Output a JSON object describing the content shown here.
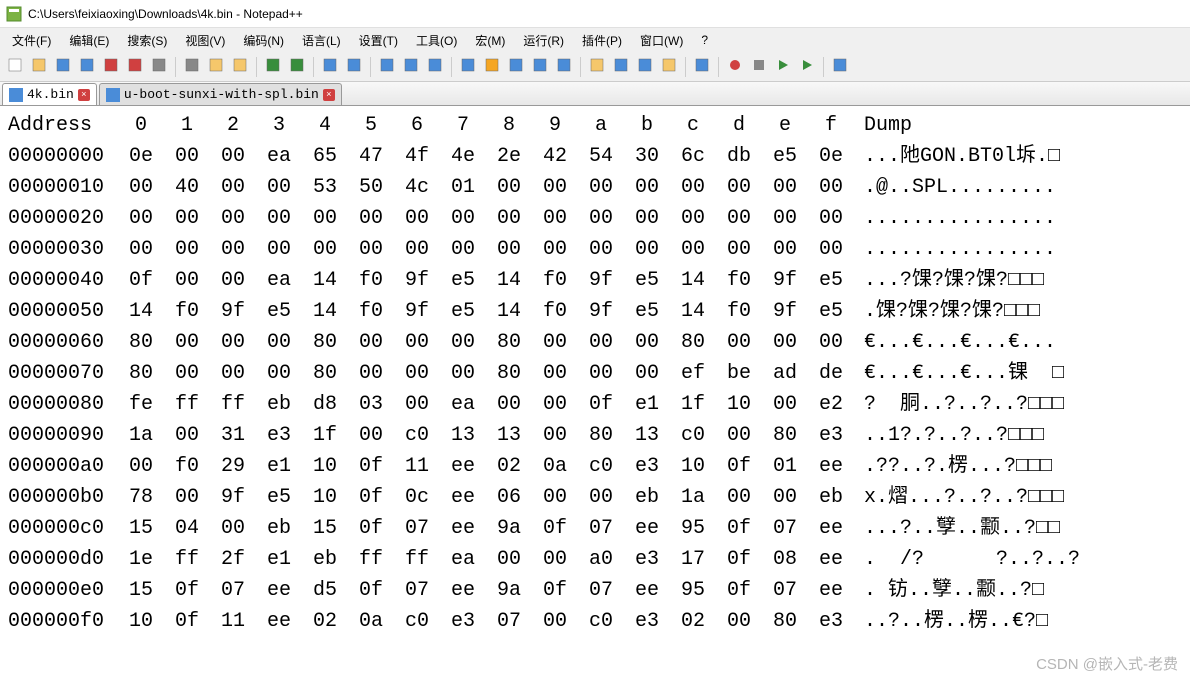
{
  "title": "C:\\Users\\feixiaoxing\\Downloads\\4k.bin - Notepad++",
  "menu": {
    "items": [
      {
        "label": "文件(F)",
        "key": "F"
      },
      {
        "label": "编辑(E)",
        "key": "E"
      },
      {
        "label": "搜索(S)",
        "key": "S"
      },
      {
        "label": "视图(V)",
        "key": "V"
      },
      {
        "label": "编码(N)",
        "key": "N"
      },
      {
        "label": "语言(L)",
        "key": "L"
      },
      {
        "label": "设置(T)",
        "key": "T"
      },
      {
        "label": "工具(O)",
        "key": "O"
      },
      {
        "label": "宏(M)",
        "key": "M"
      },
      {
        "label": "运行(R)",
        "key": "R"
      },
      {
        "label": "插件(P)",
        "key": "P"
      },
      {
        "label": "窗口(W)",
        "key": "W"
      },
      {
        "label": "?",
        "key": "?"
      }
    ]
  },
  "toolbar_icons": [
    "new-file",
    "open-file",
    "save",
    "save-all",
    "close",
    "close-all",
    "print",
    "sep",
    "cut",
    "copy",
    "paste",
    "sep",
    "undo",
    "redo",
    "sep",
    "find",
    "replace",
    "sep",
    "zoom-in",
    "zoom-out",
    "sync",
    "sep",
    "wordwrap",
    "all-chars",
    "indent",
    "fold",
    "unfold",
    "sep",
    "doc-map",
    "doc-list",
    "func-list",
    "folder",
    "sep",
    "monitor",
    "sep",
    "record",
    "stop",
    "play",
    "play-multi",
    "sep",
    "highlight"
  ],
  "tabs": [
    {
      "label": "4k.bin",
      "active": true
    },
    {
      "label": "u-boot-sunxi-with-spl.bin",
      "active": false
    }
  ],
  "hex": {
    "header_addr": "Address",
    "header_cols": [
      "0",
      "1",
      "2",
      "3",
      "4",
      "5",
      "6",
      "7",
      "8",
      "9",
      "a",
      "b",
      "c",
      "d",
      "e",
      "f"
    ],
    "header_dump": "Dump",
    "rows": [
      {
        "addr": "00000000",
        "b": [
          "0e",
          "00",
          "00",
          "ea",
          "65",
          "47",
          "4f",
          "4e",
          "2e",
          "42",
          "54",
          "30",
          "6c",
          "db",
          "e5",
          "0e"
        ],
        "dump": "...阤GON.BT0l坼.□"
      },
      {
        "addr": "00000010",
        "b": [
          "00",
          "40",
          "00",
          "00",
          "53",
          "50",
          "4c",
          "01",
          "00",
          "00",
          "00",
          "00",
          "00",
          "00",
          "00",
          "00"
        ],
        "dump": ".@..SPL........."
      },
      {
        "addr": "00000020",
        "b": [
          "00",
          "00",
          "00",
          "00",
          "00",
          "00",
          "00",
          "00",
          "00",
          "00",
          "00",
          "00",
          "00",
          "00",
          "00",
          "00"
        ],
        "dump": "................"
      },
      {
        "addr": "00000030",
        "b": [
          "00",
          "00",
          "00",
          "00",
          "00",
          "00",
          "00",
          "00",
          "00",
          "00",
          "00",
          "00",
          "00",
          "00",
          "00",
          "00"
        ],
        "dump": "................"
      },
      {
        "addr": "00000040",
        "b": [
          "0f",
          "00",
          "00",
          "ea",
          "14",
          "f0",
          "9f",
          "e5",
          "14",
          "f0",
          "9f",
          "e5",
          "14",
          "f0",
          "9f",
          "e5"
        ],
        "dump": "...?馃?馃?馃?□□□"
      },
      {
        "addr": "00000050",
        "b": [
          "14",
          "f0",
          "9f",
          "e5",
          "14",
          "f0",
          "9f",
          "e5",
          "14",
          "f0",
          "9f",
          "e5",
          "14",
          "f0",
          "9f",
          "e5"
        ],
        "dump": ".馃?馃?馃?馃?□□□"
      },
      {
        "addr": "00000060",
        "b": [
          "80",
          "00",
          "00",
          "00",
          "80",
          "00",
          "00",
          "00",
          "80",
          "00",
          "00",
          "00",
          "80",
          "00",
          "00",
          "00"
        ],
        "dump": "€...€...€...€..."
      },
      {
        "addr": "00000070",
        "b": [
          "80",
          "00",
          "00",
          "00",
          "80",
          "00",
          "00",
          "00",
          "80",
          "00",
          "00",
          "00",
          "ef",
          "be",
          "ad",
          "de"
        ],
        "dump": "€...€...€...锞  □"
      },
      {
        "addr": "00000080",
        "b": [
          "fe",
          "ff",
          "ff",
          "eb",
          "d8",
          "03",
          "00",
          "ea",
          "00",
          "00",
          "0f",
          "e1",
          "1f",
          "10",
          "00",
          "e2"
        ],
        "dump": "?  胴..?..?..?□□□"
      },
      {
        "addr": "00000090",
        "b": [
          "1a",
          "00",
          "31",
          "e3",
          "1f",
          "00",
          "c0",
          "13",
          "13",
          "00",
          "80",
          "13",
          "c0",
          "00",
          "80",
          "e3"
        ],
        "dump": "..1?.?..?..?□□□"
      },
      {
        "addr": "000000a0",
        "b": [
          "00",
          "f0",
          "29",
          "e1",
          "10",
          "0f",
          "11",
          "ee",
          "02",
          "0a",
          "c0",
          "e3",
          "10",
          "0f",
          "01",
          "ee"
        ],
        "dump": ".??..?.楞...?□□□"
      },
      {
        "addr": "000000b0",
        "b": [
          "78",
          "00",
          "9f",
          "e5",
          "10",
          "0f",
          "0c",
          "ee",
          "06",
          "00",
          "00",
          "eb",
          "1a",
          "00",
          "00",
          "eb"
        ],
        "dump": "x.熠...?..?..?□□□"
      },
      {
        "addr": "000000c0",
        "b": [
          "15",
          "04",
          "00",
          "eb",
          "15",
          "0f",
          "07",
          "ee",
          "9a",
          "0f",
          "07",
          "ee",
          "95",
          "0f",
          "07",
          "ee"
        ],
        "dump": "...?..孼..颥..?□□"
      },
      {
        "addr": "000000d0",
        "b": [
          "1e",
          "ff",
          "2f",
          "e1",
          "eb",
          "ff",
          "ff",
          "ea",
          "00",
          "00",
          "a0",
          "e3",
          "17",
          "0f",
          "08",
          "ee"
        ],
        "dump": ".  /?      ?..?..?"
      },
      {
        "addr": "000000e0",
        "b": [
          "15",
          "0f",
          "07",
          "ee",
          "d5",
          "0f",
          "07",
          "ee",
          "9a",
          "0f",
          "07",
          "ee",
          "95",
          "0f",
          "07",
          "ee"
        ],
        "dump": ". 钫..孼..颥..?□"
      },
      {
        "addr": "000000f0",
        "b": [
          "10",
          "0f",
          "11",
          "ee",
          "02",
          "0a",
          "c0",
          "e3",
          "07",
          "00",
          "c0",
          "e3",
          "02",
          "00",
          "80",
          "e3"
        ],
        "dump": "..?..楞..楞..€?□"
      }
    ]
  },
  "watermark": "CSDN @嵌入式-老费"
}
